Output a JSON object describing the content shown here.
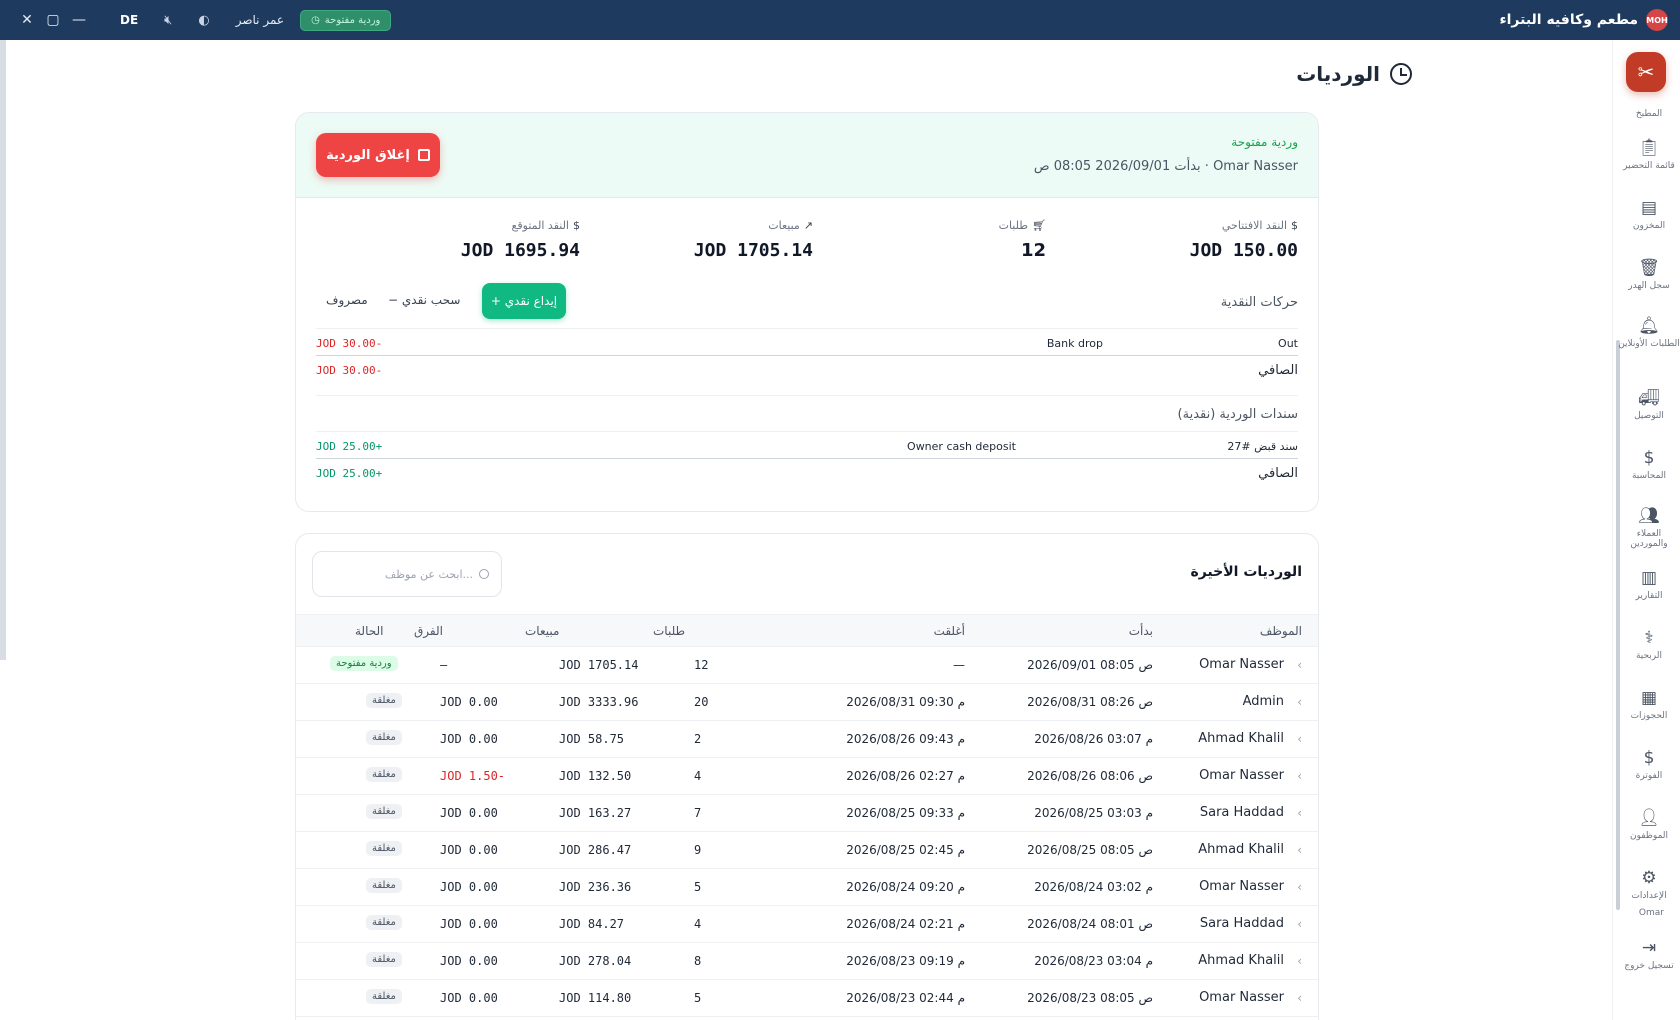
{
  "titlebar": {
    "app_name": "مطعم وكافيه البتراء",
    "logo_text": "MOH",
    "shift_badge": "وردية مفتوحة",
    "user": "عمر ناصر",
    "language": "DE",
    "controls": {
      "close": "✕",
      "maximize": "▢",
      "minimize": "—"
    }
  },
  "sidebar": {
    "items": [
      {
        "label": "المطبخ",
        "icon": "chef-icon"
      },
      {
        "label": "قائمة التحضير",
        "icon": "clipboard-icon"
      },
      {
        "label": "المخزون",
        "icon": "inventory-icon"
      },
      {
        "label": "سجل الهدر",
        "icon": "trash-icon"
      },
      {
        "label": "الطلبات الأونلاين",
        "icon": "bell-icon"
      },
      {
        "label": "التوصيل",
        "icon": "truck-icon"
      },
      {
        "label": "المحاسبة",
        "icon": "dollar-icon"
      },
      {
        "label": "العملاء والموردين",
        "icon": "users-icon"
      },
      {
        "label": "التقارير",
        "icon": "chart-icon"
      },
      {
        "label": "الربحية",
        "icon": "stethoscope-icon"
      },
      {
        "label": "الحجوزات",
        "icon": "calendar-icon"
      },
      {
        "label": "الفوترة",
        "icon": "invoice-icon"
      },
      {
        "label": "الموظفون",
        "icon": "staff-icon"
      },
      {
        "label": "الإعدادات",
        "icon": "gear-icon"
      }
    ],
    "user": "Omar",
    "logout": "تسجيل خروج"
  },
  "page": {
    "title": "الورديات"
  },
  "current_shift": {
    "status": "وردية مفتوحة",
    "started": "بدأت 2026/09/01 08:05 ص · Omar Nasser",
    "close_button": "إغلاق الوردية",
    "stats": {
      "opening_cash_label": "النقد الافتتاحي",
      "opening_cash": "JOD 150.00",
      "orders_label": "طلبات",
      "orders": "12",
      "sales_label": "مبيعات",
      "sales": "JOD 1705.14",
      "expected_cash_label": "النقد المتوقع",
      "expected_cash": "JOD 1695.94"
    },
    "cash_movements_title": "حركات النقدية",
    "buttons": {
      "deposit": "+ إيداع نقدي",
      "withdraw": "− سحب نقدي",
      "expense": "مصروف"
    },
    "movements": [
      {
        "type": "Out",
        "note": "Bank drop",
        "amount": "JOD 30.00-"
      }
    ],
    "movements_net_label": "الصافي",
    "movements_net": "JOD 30.00-",
    "vouchers_title": "سندات الوردية (نقدية)",
    "vouchers": [
      {
        "ref": "سند قبض #27",
        "note": "Owner cash deposit",
        "amount": "JOD 25.00+"
      }
    ],
    "vouchers_net_label": "الصافي",
    "vouchers_net": "JOD 25.00+"
  },
  "recent": {
    "title": "الورديات الأخيرة",
    "search_placeholder": "ابحث عن موظف...",
    "columns": {
      "employee": "الموظف",
      "started": "بدأت",
      "closed": "أغلقت",
      "orders": "طلبات",
      "sales": "مبيعات",
      "diff": "الفرق",
      "status": "الحالة"
    },
    "rows": [
      {
        "employee": "Omar Nasser",
        "started": "2026/09/01 08:05 ص",
        "closed": "—",
        "orders": "12",
        "sales": "JOD 1705.14",
        "diff": "—",
        "status": "وردية مفتوحة",
        "open": true
      },
      {
        "employee": "Admin",
        "started": "2026/08/31 08:26 ص",
        "closed": "2026/08/31 09:30 م",
        "orders": "20",
        "sales": "JOD 3333.96",
        "diff": "JOD 0.00",
        "status": "مغلقة"
      },
      {
        "employee": "Ahmad Khalil",
        "started": "2026/08/26 03:07 م",
        "closed": "2026/08/26 09:43 م",
        "orders": "2",
        "sales": "JOD 58.75",
        "diff": "JOD 0.00",
        "status": "مغلقة"
      },
      {
        "employee": "Omar Nasser",
        "started": "2026/08/26 08:06 ص",
        "closed": "2026/08/26 02:27 م",
        "orders": "4",
        "sales": "JOD 132.50",
        "diff": "JOD 1.50-",
        "status": "مغلقة",
        "neg": true
      },
      {
        "employee": "Sara Haddad",
        "started": "2026/08/25 03:03 م",
        "closed": "2026/08/25 09:33 م",
        "orders": "7",
        "sales": "JOD 163.27",
        "diff": "JOD 0.00",
        "status": "مغلقة"
      },
      {
        "employee": "Ahmad Khalil",
        "started": "2026/08/25 08:05 ص",
        "closed": "2026/08/25 02:45 م",
        "orders": "9",
        "sales": "JOD 286.47",
        "diff": "JOD 0.00",
        "status": "مغلقة"
      },
      {
        "employee": "Omar Nasser",
        "started": "2026/08/24 03:02 م",
        "closed": "2026/08/24 09:20 م",
        "orders": "5",
        "sales": "JOD 236.36",
        "diff": "JOD 0.00",
        "status": "مغلقة"
      },
      {
        "employee": "Sara Haddad",
        "started": "2026/08/24 08:01 ص",
        "closed": "2026/08/24 02:21 م",
        "orders": "4",
        "sales": "JOD 84.27",
        "diff": "JOD 0.00",
        "status": "مغلقة"
      },
      {
        "employee": "Ahmad Khalil",
        "started": "2026/08/23 03:04 م",
        "closed": "2026/08/23 09:19 م",
        "orders": "8",
        "sales": "JOD 278.04",
        "diff": "JOD 0.00",
        "status": "مغلقة"
      },
      {
        "employee": "Omar Nasser",
        "started": "2026/08/23 08:05 ص",
        "closed": "2026/08/23 02:44 م",
        "orders": "5",
        "sales": "JOD 114.80",
        "diff": "JOD 0.00",
        "status": "مغلقة"
      }
    ]
  },
  "colors": {
    "titlebar": "#1e3a5f",
    "accent_green": "#10b981",
    "danger": "#ef4444",
    "brand": "#c23b26"
  }
}
